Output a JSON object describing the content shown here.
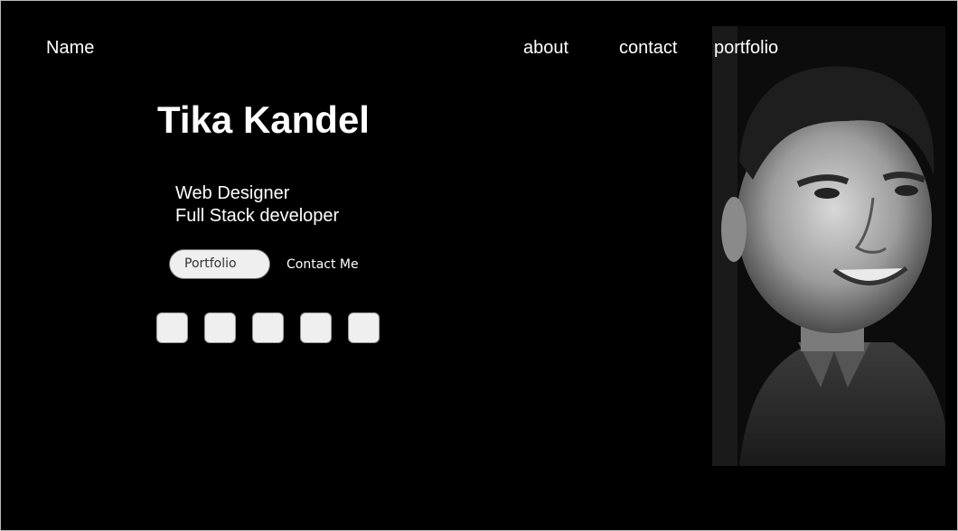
{
  "header": {
    "brand": "Name",
    "nav": {
      "about": "about",
      "contact": "contact",
      "portfolio": "portfolio"
    }
  },
  "hero": {
    "name": "Tika Kandel",
    "roles": [
      "Web Designer",
      "Full Stack developer"
    ],
    "buttons": {
      "portfolio": "Portfolio",
      "contact": "Contact Me"
    },
    "social_buttons_count": 5
  },
  "photo": {
    "subject": "grayscale portrait photo of a smiling man"
  }
}
